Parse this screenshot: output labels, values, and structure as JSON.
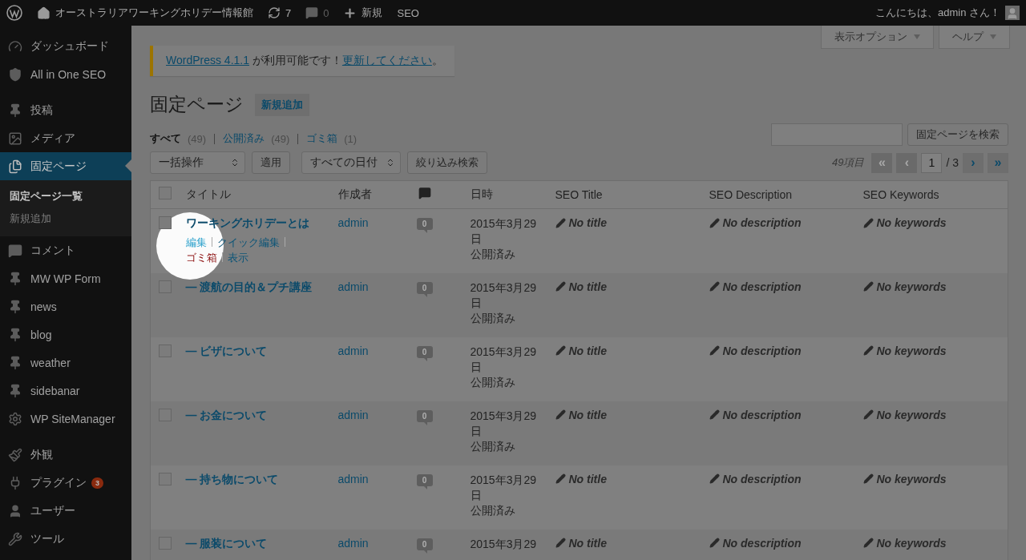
{
  "admin_bar": {
    "site_name": "オーストラリアワーキングホリデー情報館",
    "updates": "7",
    "comments": "0",
    "new": "新規",
    "seo": "SEO",
    "greeting": "こんにちは、admin さん！"
  },
  "screen_meta": [
    "表示オプション",
    "ヘルプ"
  ],
  "sidebar": {
    "sections": [
      {
        "items": [
          {
            "kind": "dashboard",
            "label": "ダッシュボード",
            "selected": false
          },
          {
            "kind": "shield",
            "label": "All in One SEO",
            "selected": false
          }
        ]
      },
      {
        "items": [
          {
            "kind": "pin",
            "label": "投稿",
            "selected": false
          },
          {
            "kind": "media",
            "label": "メディア",
            "selected": false
          },
          {
            "kind": "pages",
            "label": "固定ページ",
            "selected": true,
            "children": [
              {
                "label": "固定ページ一覧",
                "selected": true
              },
              {
                "label": "新規追加",
                "selected": false
              }
            ]
          },
          {
            "kind": "comment",
            "label": "コメント",
            "selected": false
          },
          {
            "kind": "pin",
            "label": "MW WP Form",
            "selected": false
          },
          {
            "kind": "pin",
            "label": "news",
            "selected": false
          },
          {
            "kind": "pin",
            "label": "blog",
            "selected": false
          },
          {
            "kind": "pin",
            "label": "weather",
            "selected": false
          },
          {
            "kind": "pin",
            "label": "sidebanar",
            "selected": false
          },
          {
            "kind": "gear",
            "label": "WP SiteManager",
            "selected": false
          }
        ]
      },
      {
        "items": [
          {
            "kind": "brush",
            "label": "外観",
            "selected": false
          },
          {
            "kind": "plug",
            "label": "プラグイン",
            "badge": "3",
            "selected": false
          },
          {
            "kind": "user",
            "label": "ユーザー",
            "selected": false
          },
          {
            "kind": "wrench",
            "label": "ツール",
            "selected": false
          }
        ]
      }
    ]
  },
  "notice": {
    "parts": [
      {
        "text": "WordPress 4.1.1",
        "link": true
      },
      {
        "text": " が利用可能です！",
        "link": false
      },
      {
        "text": "更新してください",
        "link": true
      },
      {
        "text": "。",
        "link": false
      }
    ]
  },
  "heading": {
    "title": "固定ページ",
    "add_new": "新規追加"
  },
  "filters": [
    {
      "label": "すべて",
      "count": "(49)",
      "selected": true
    },
    {
      "label": "公開済み",
      "count": "(49)",
      "selected": false
    },
    {
      "label": "ゴミ箱",
      "count": "(1)",
      "selected": false
    }
  ],
  "search": {
    "button": "固定ページを検索"
  },
  "toolbar": {
    "bulk": "一括操作",
    "apply": "適用",
    "dates": "すべての日付",
    "filter": "絞り込み検索"
  },
  "pagination": {
    "count": "49項目",
    "page": "1",
    "total": "/ 3",
    "buttons": [
      {
        "label": "«",
        "disabled": true
      },
      {
        "label": "‹",
        "disabled": true
      },
      {
        "label": "›",
        "disabled": false
      },
      {
        "label": "»",
        "disabled": false
      }
    ]
  },
  "table": {
    "select_all_checked": false,
    "columns": [
      {
        "kind": "text",
        "label": "タイトル"
      },
      {
        "kind": "text",
        "label": "作成者"
      },
      {
        "kind": "comments"
      },
      {
        "kind": "text",
        "label": "日時"
      },
      {
        "kind": "text",
        "label": "SEO Title"
      },
      {
        "kind": "text",
        "label": "SEO Description"
      },
      {
        "kind": "text",
        "label": "SEO Keywords"
      }
    ],
    "rows": [
      {
        "title": "ワーキングホリデーとは",
        "checked": false,
        "spotlight": true,
        "actions": [
          {
            "kind": "link",
            "label": "編集"
          },
          {
            "kind": "link",
            "label": "クイック編集"
          },
          {
            "kind": "trash",
            "label": "ゴミ箱"
          },
          {
            "kind": "link",
            "label": "表示"
          }
        ],
        "author": "admin",
        "comments": "0",
        "date": "2015年3月29日",
        "status": "公開済み",
        "seo_title": "No title",
        "seo_description": "No description",
        "seo_keywords": "No keywords"
      },
      {
        "title": "— 渡航の目的＆プチ講座",
        "checked": false,
        "spotlight": false,
        "author": "admin",
        "comments": "0",
        "date": "2015年3月29日",
        "status": "公開済み",
        "seo_title": "No title",
        "seo_description": "No description",
        "seo_keywords": "No keywords"
      },
      {
        "title": "— ビザについて",
        "checked": false,
        "spotlight": false,
        "author": "admin",
        "comments": "0",
        "date": "2015年3月29日",
        "status": "公開済み",
        "seo_title": "No title",
        "seo_description": "No description",
        "seo_keywords": "No keywords"
      },
      {
        "title": "— お金について",
        "checked": false,
        "spotlight": false,
        "author": "admin",
        "comments": "0",
        "date": "2015年3月29日",
        "status": "公開済み",
        "seo_title": "No title",
        "seo_description": "No description",
        "seo_keywords": "No keywords"
      },
      {
        "title": "— 持ち物について",
        "checked": false,
        "spotlight": false,
        "author": "admin",
        "comments": "0",
        "date": "2015年3月29日",
        "status": "公開済み",
        "seo_title": "No title",
        "seo_description": "No description",
        "seo_keywords": "No keywords"
      },
      {
        "title": "— 服装について",
        "checked": false,
        "spotlight": false,
        "author": "admin",
        "comments": "0",
        "date": "2015年3月29",
        "seo_title": "No title",
        "seo_description": "No description",
        "seo_keywords": "No keywords"
      }
    ]
  }
}
